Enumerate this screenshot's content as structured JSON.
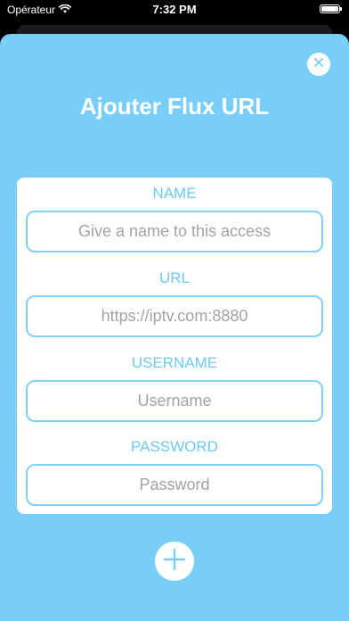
{
  "status_bar": {
    "carrier": "Opérateur",
    "time": "7:32 PM",
    "wifi_icon": "wifi-icon",
    "battery_icon": "battery-icon"
  },
  "sheet": {
    "title": "Ajouter Flux URL",
    "close_icon": "close-icon",
    "add_icon": "plus-icon"
  },
  "form": {
    "name": {
      "label": "NAME",
      "placeholder": "Give a name to this access",
      "value": ""
    },
    "url": {
      "label": "URL",
      "placeholder": "https://iptv.com:8880",
      "value": ""
    },
    "username": {
      "label": "USERNAME",
      "placeholder": "Username",
      "value": ""
    },
    "password": {
      "label": "PASSWORD",
      "placeholder": "Password",
      "value": ""
    }
  },
  "colors": {
    "sheet_background": "#79cdf9",
    "accent": "#6cc9f3",
    "input_border": "#7fd1f8",
    "card_background": "#ffffff"
  }
}
